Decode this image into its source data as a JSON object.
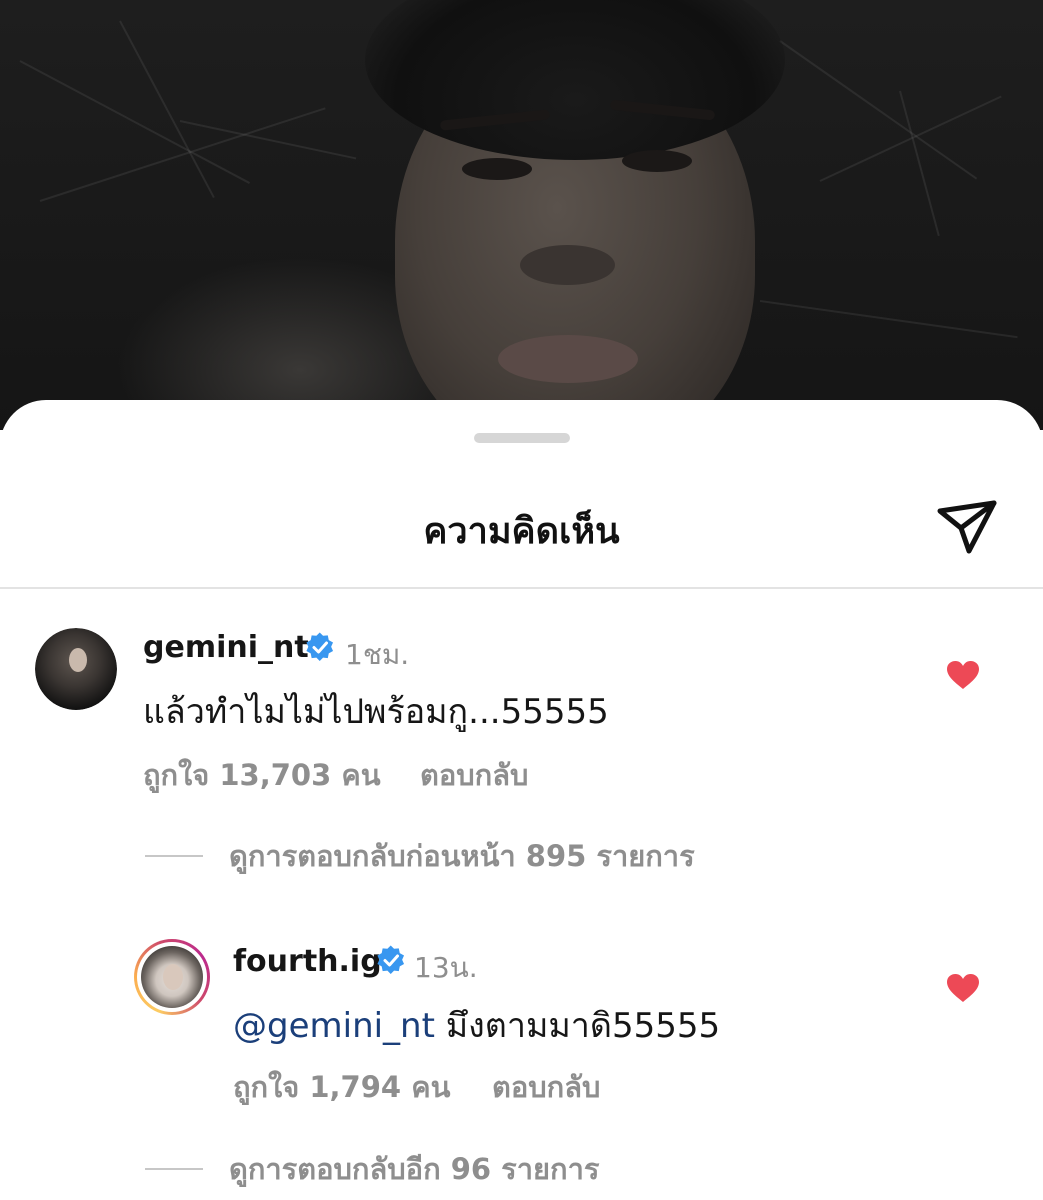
{
  "sheet": {
    "title": "ความคิดเห็น",
    "share_icon": "paper-plane-icon"
  },
  "comments": [
    {
      "username": "gemini_nt",
      "verified": true,
      "time": "1ชม.",
      "text": "แล้วทำไมไม่ไปพร้อมกู...55555",
      "likes": "ถูกใจ 13,703 คน",
      "reply_label": "ตอบกลับ",
      "liked": true,
      "view_replies": "ดูการตอบกลับก่อนหน้า 895 รายการ"
    },
    {
      "username": "fourth.ig",
      "verified": true,
      "has_story_ring": true,
      "time": "13น.",
      "mention": "@gemini_nt",
      "text": "มึงตามมาดิ55555",
      "likes": "ถูกใจ 1,794 คน",
      "reply_label": "ตอบกลับ",
      "liked": true,
      "view_replies": "ดูการตอบกลับอีก 96 รายการ"
    }
  ],
  "colors": {
    "heart": "#ed4956",
    "verified": "#3897f0",
    "muted": "#8e8e8e",
    "mention": "#1b3f7a"
  }
}
